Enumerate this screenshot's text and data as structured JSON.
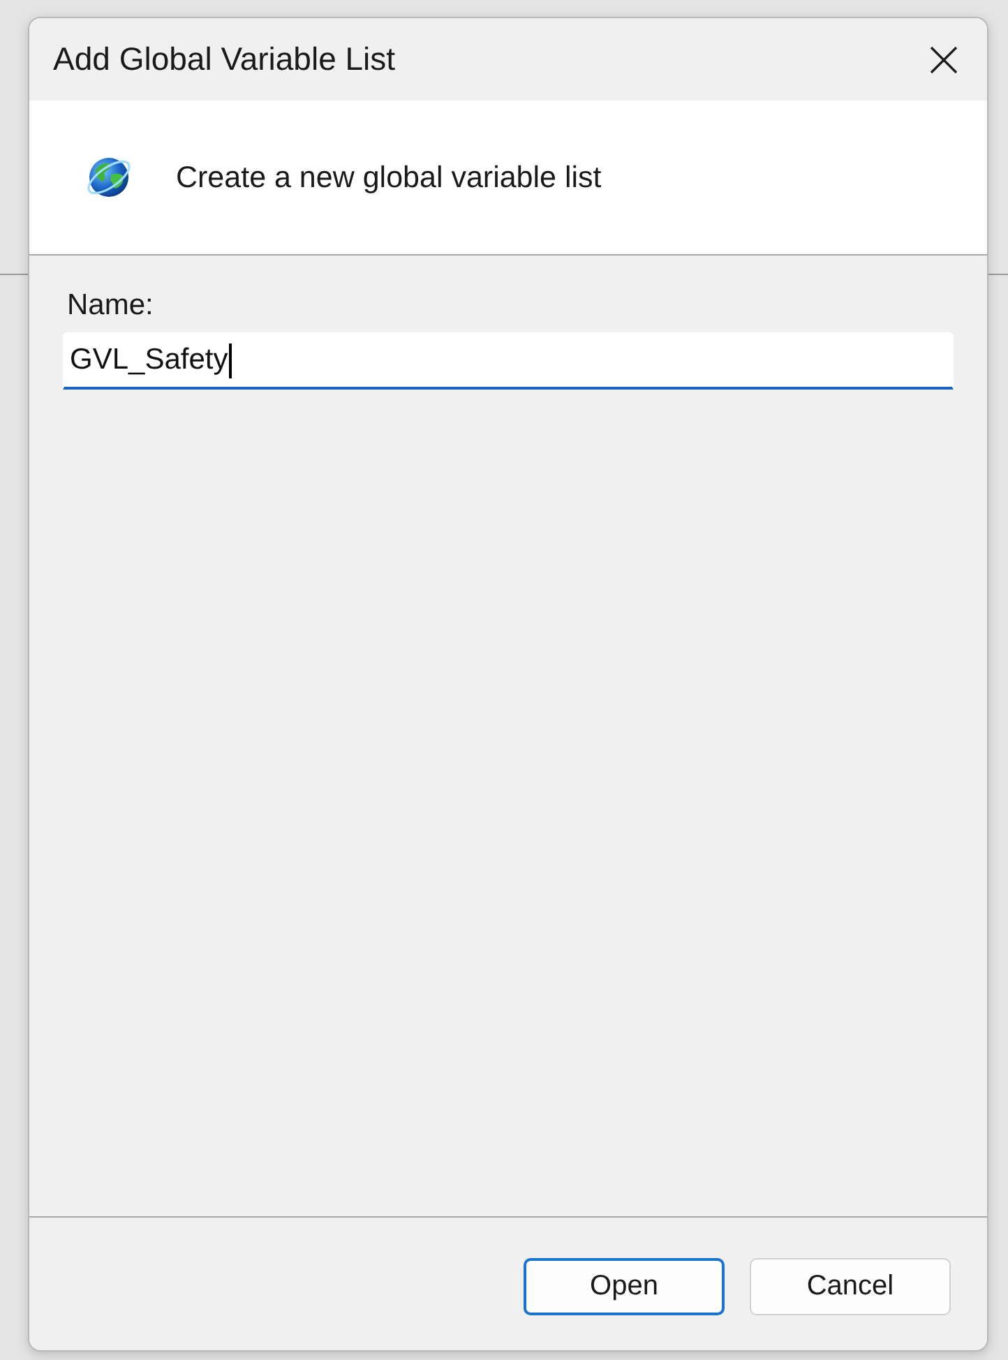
{
  "window": {
    "title": "Add Global Variable List"
  },
  "header": {
    "text": "Create a new global variable list"
  },
  "form": {
    "label": "Name:",
    "field": {
      "value": "GVL_Safety",
      "focused": true
    }
  },
  "buttons": [
    {
      "label": "Open",
      "default": true
    },
    {
      "label": "Cancel",
      "default": false
    }
  ]
}
